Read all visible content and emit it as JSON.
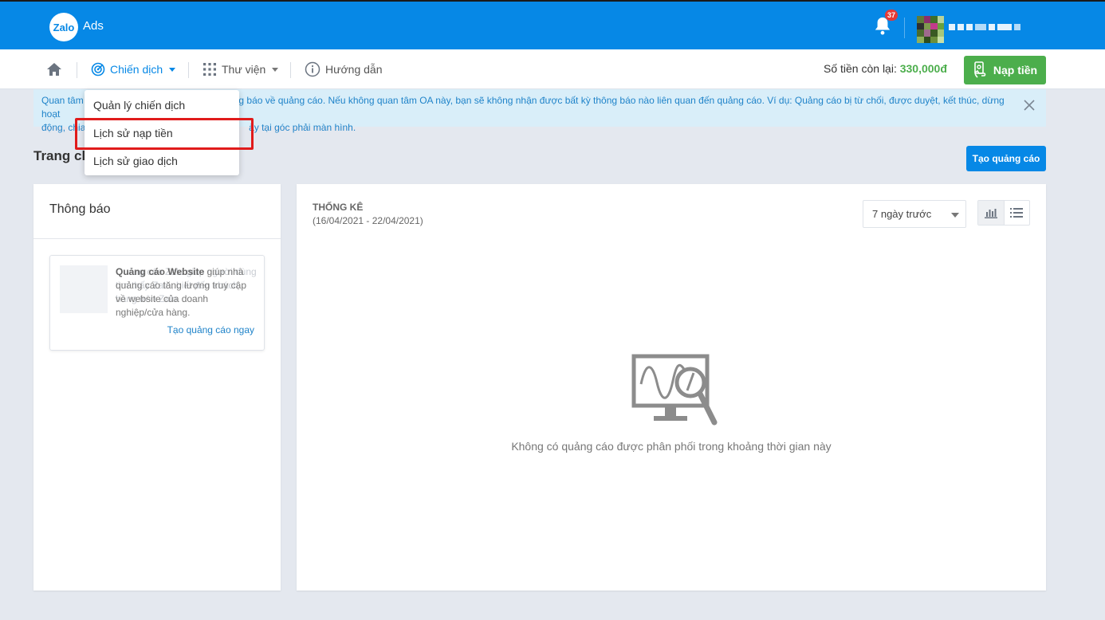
{
  "header": {
    "logo_text": "Zalo",
    "brand_suffix": "Ads",
    "notification_count": "37"
  },
  "nav": {
    "campaign_label": "Chiến dịch",
    "library_label": "Thư viện",
    "guide_label": "Hướng dẫn",
    "balance_label": "Số tiền còn lại:",
    "balance_value": "330,000đ",
    "topup_label": "Nạp tiền"
  },
  "campaign_menu": {
    "items": [
      {
        "label": "Quản lý chiến dịch"
      },
      {
        "label": "Lịch sử nạp tiền"
      },
      {
        "label": "Lịch sử giao dịch"
      }
    ]
  },
  "notice": {
    "line1_left": "Quan tâm",
    "line1_right": "g báo về quảng cáo. Nếu không quan tâm OA này, bạn sẽ không nhận được bất kỳ thông báo nào liên quan đến quảng cáo. Ví dụ: Quảng cáo bị từ chối, được duyệt, kết thúc, dừng hoạt",
    "line2_left": "động, chia",
    "line2_right": "ày tại góc phải màn hình."
  },
  "page": {
    "heading": "Trang ch",
    "create_ad_label": "Tạo quảng cáo"
  },
  "notifications_panel": {
    "title": "Thông báo",
    "promo_ghost_text": "Quảng cáo Zalo giúp người dùng tìm thấy Zalo, biết đến khách hàng trên Zalo.",
    "promo_title": "Quảng cáo Website",
    "promo_body": "giúp nhà quảng cáo tăng lượng truy cập về website của doanh nghiệp/cửa hàng.",
    "promo_link": "Tạo quảng cáo ngay"
  },
  "stats_panel": {
    "title": "THỐNG KÊ",
    "date_range": "(16/04/2021 - 22/04/2021)",
    "range_select_value": "7 ngày trước",
    "empty_message": "Không có quảng cáo được phân phối trong khoảng thời gian này"
  },
  "colors": {
    "brand_blue": "#0688e6",
    "topup_green": "#4cae4c",
    "highlight_red": "#e01b1b"
  },
  "icons": [
    "home-icon",
    "target-icon",
    "grid-icon",
    "info-icon",
    "bell-icon",
    "hand-money-icon",
    "close-icon",
    "bar-chart-icon",
    "list-icon",
    "monitor-magnifier-icon"
  ]
}
